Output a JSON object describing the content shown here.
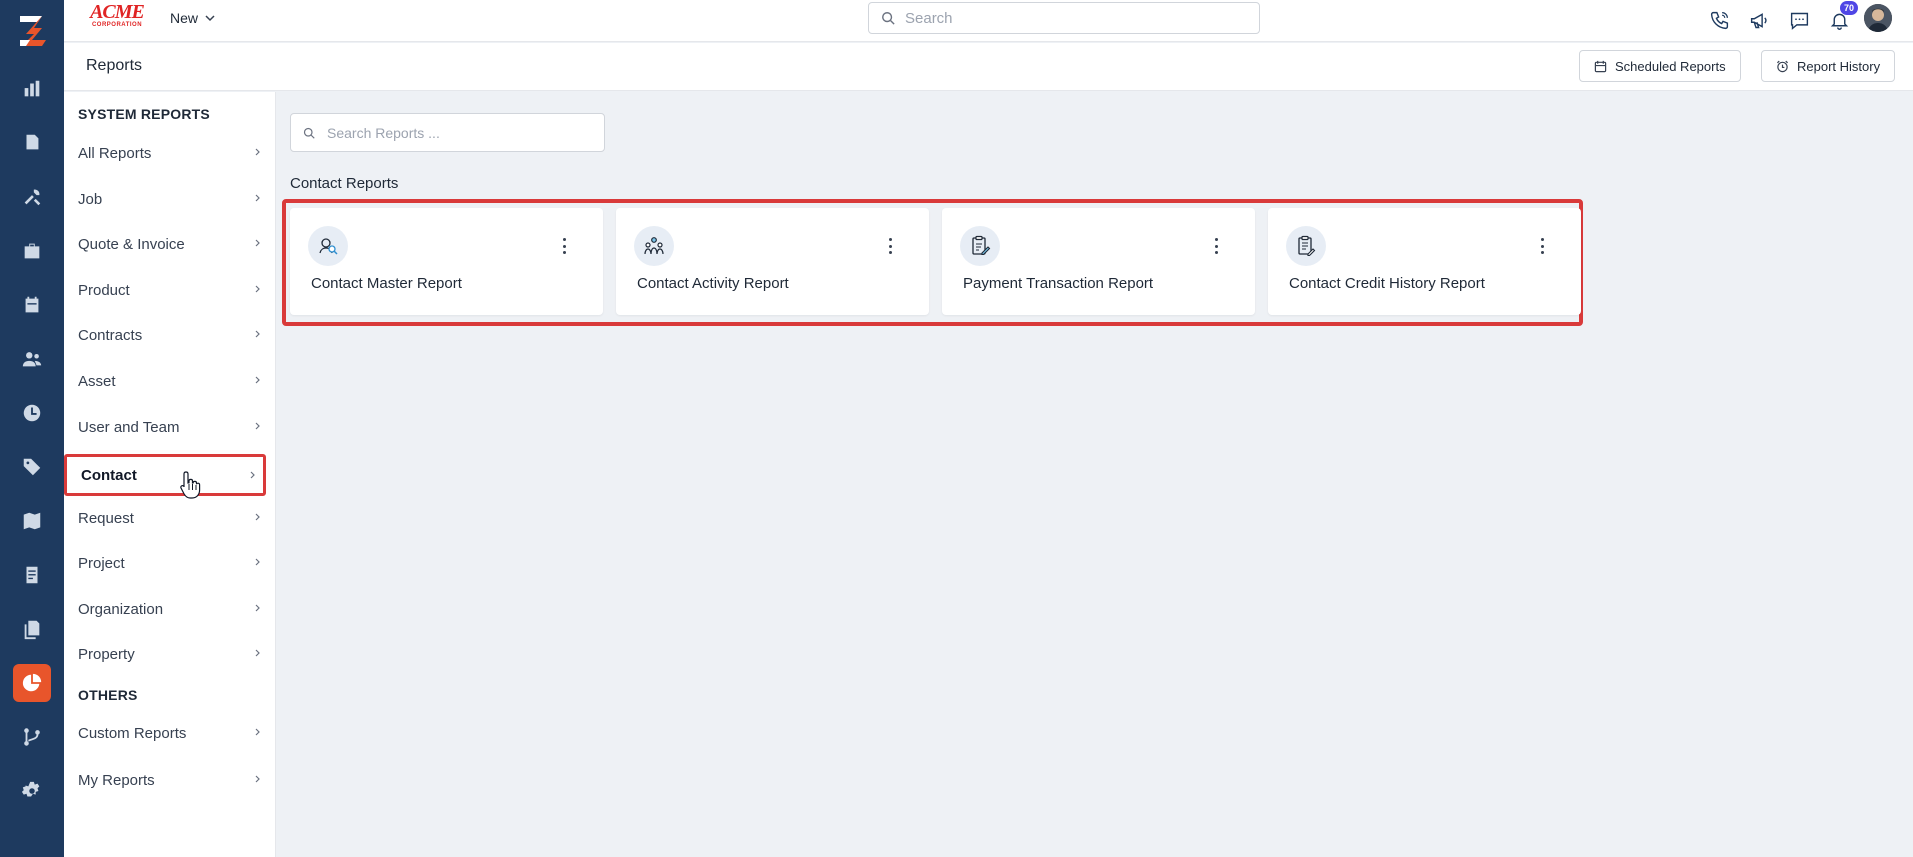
{
  "brand": {
    "name": "ACME",
    "tagline": "CORPORATION"
  },
  "topbar": {
    "new_label": "New",
    "search_placeholder": "Search",
    "notification_count": "70",
    "icons": [
      "phone-icon",
      "megaphone-icon",
      "chat-icon",
      "bell-icon"
    ]
  },
  "rail": {
    "items": [
      "dashboard-icon",
      "jobs-icon",
      "tools-icon",
      "briefcase-icon",
      "calendar-icon",
      "users-icon",
      "clock-icon",
      "tag-icon",
      "map-icon",
      "invoice-icon",
      "documents-icon",
      "reports-icon",
      "workflow-icon",
      "settings-icon"
    ],
    "active": "reports-icon",
    "accent": "#e8552b",
    "background": "#1e3a5f"
  },
  "page": {
    "title": "Reports",
    "scheduled_label": "Scheduled Reports",
    "history_label": "Report History"
  },
  "menu": {
    "system_title": "SYSTEM REPORTS",
    "items": [
      {
        "label": "All Reports"
      },
      {
        "label": "Job"
      },
      {
        "label": "Quote & Invoice"
      },
      {
        "label": "Product"
      },
      {
        "label": "Contracts"
      },
      {
        "label": "Asset"
      },
      {
        "label": "User and Team"
      },
      {
        "label": "Contact"
      },
      {
        "label": "Request"
      },
      {
        "label": "Project"
      },
      {
        "label": "Organization"
      },
      {
        "label": "Property"
      }
    ],
    "active_item": "Contact",
    "others_title": "OTHERS",
    "others": [
      {
        "label": "Custom Reports"
      },
      {
        "label": "My Reports"
      }
    ]
  },
  "main": {
    "search_placeholder": "Search Reports ...",
    "group_title": "Contact Reports",
    "cards": [
      {
        "name": "Contact Master Report",
        "icon": "contact-search-icon"
      },
      {
        "name": "Contact Activity Report",
        "icon": "group-activity-icon"
      },
      {
        "name": "Payment Transaction Report",
        "icon": "clipboard-edit-icon"
      },
      {
        "name": "Contact Credit History Report",
        "icon": "clipboard-list-icon"
      }
    ]
  },
  "highlight_color": "#d93a3a"
}
